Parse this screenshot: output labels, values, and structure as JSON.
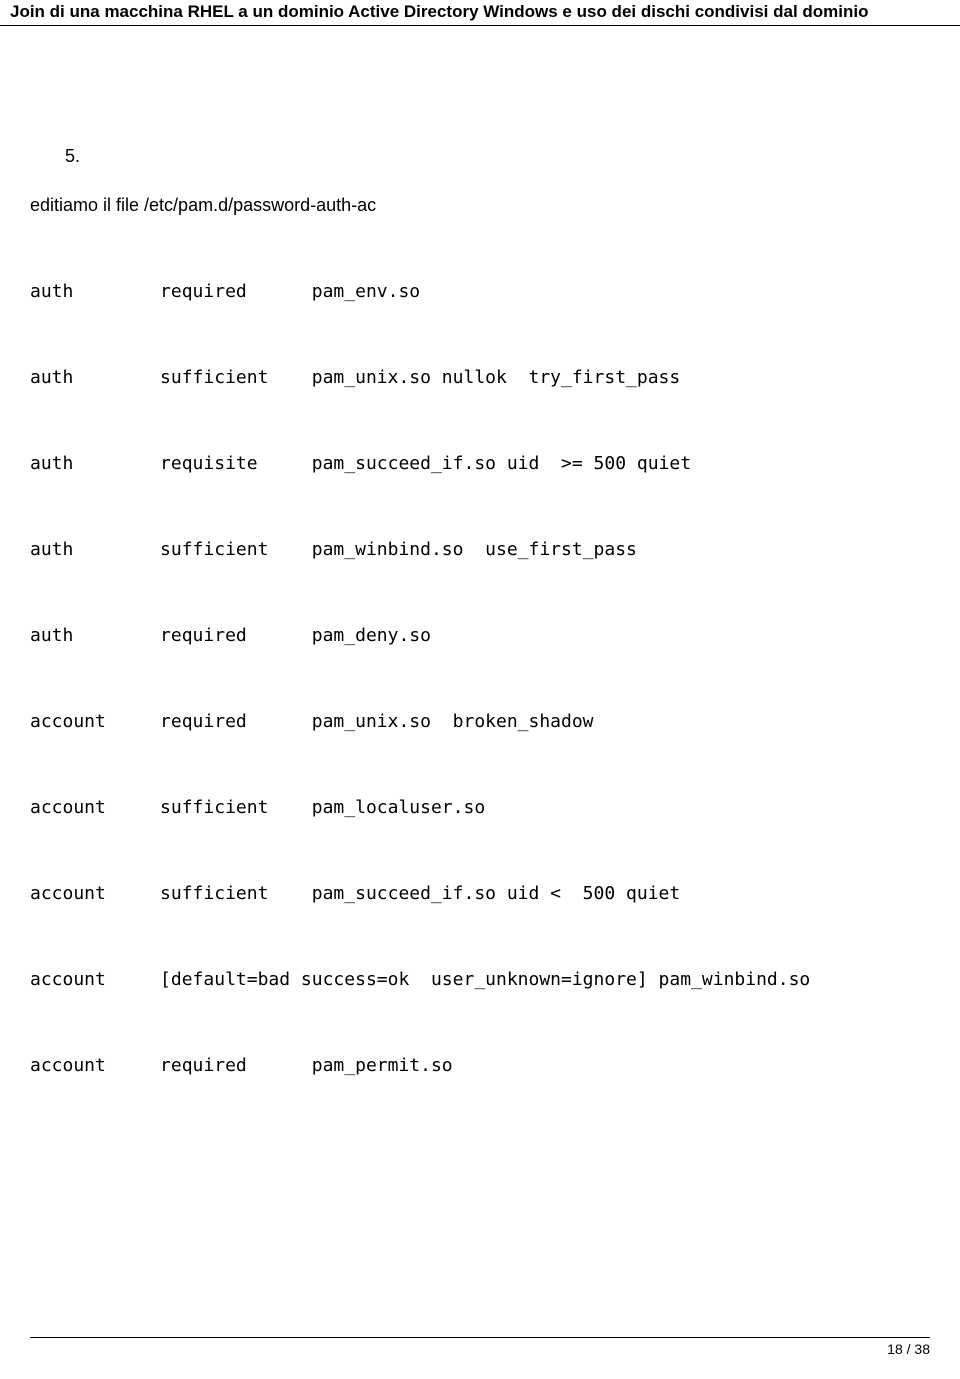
{
  "header": {
    "title": "Join di una macchina RHEL a un dominio Active Directory Windows e uso dei dischi condivisi dal dominio"
  },
  "step": {
    "number": "5.",
    "intro": "editiamo il file /etc/pam.d/password-auth-ac"
  },
  "config_lines": [
    "auth        required      pam_env.so",
    "auth        sufficient    pam_unix.so nullok  try_first_pass",
    "auth        requisite     pam_succeed_if.so uid  >= 500 quiet",
    "auth        sufficient    pam_winbind.so  use_first_pass",
    "auth        required      pam_deny.so",
    "account     required      pam_unix.so  broken_shadow",
    "account     sufficient    pam_localuser.so",
    "account     sufficient    pam_succeed_if.so uid <  500 quiet",
    "account     [default=bad success=ok  user_unknown=ignore] pam_winbind.so",
    "account     required      pam_permit.so"
  ],
  "footer": {
    "page": "18 / 38"
  }
}
